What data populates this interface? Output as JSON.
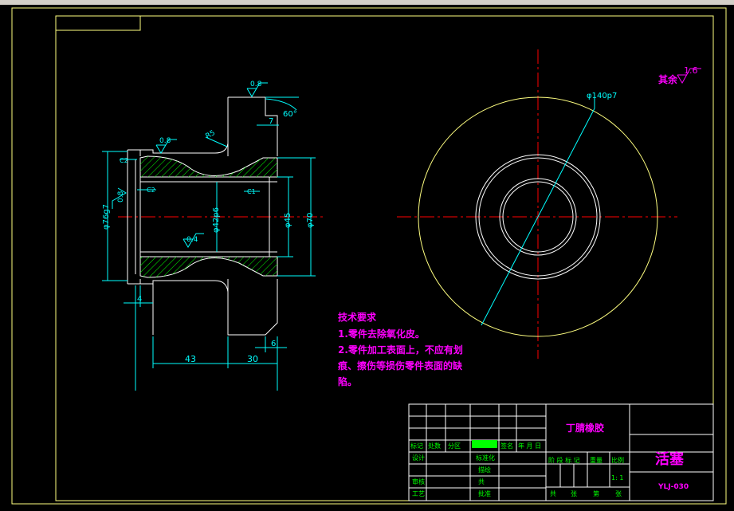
{
  "dims": {
    "d76": "φ76g7",
    "d42": "φ42p6",
    "d45": "φ45",
    "d70": "φ70",
    "d140": "φ140p7",
    "len43": "43",
    "len30": "30",
    "len4": "4",
    "len6": "6",
    "len7": "7",
    "ang60": "60°",
    "r5": "R5",
    "c2a": "C2",
    "c2b": "C2",
    "c1": "C1"
  },
  "roughness": {
    "r1": "0.8",
    "r2": "0.8",
    "r3": "0.8",
    "r4": "0.4",
    "rest_label": "其余",
    "rest_value": "1.6"
  },
  "notes": {
    "title": "技术要求",
    "line1": "1.零件去除氧化皮。",
    "line2": "2.零件加工表面上，不应有划",
    "line3": "痕、擦伤等损伤零件表面的缺",
    "line4": "陷。"
  },
  "title_block": {
    "material": "丁腈橡胶",
    "part_name": "活塞",
    "drawing_no": "YLJ-030",
    "mark": "标记",
    "count": "处数",
    "zone": "分区",
    "sign": "签名",
    "date": "年 月 日",
    "design": "设计",
    "standardize": "标准化",
    "draw": "描绘",
    "review": "审核",
    "craft": "工艺",
    "approve": "批准",
    "stage_mark": "阶 段 标 记",
    "weight": "重量",
    "scale": "比例",
    "scale_value": "1: 1",
    "total": "共",
    "sheets": "张",
    "page": "第",
    "sheet": "张"
  },
  "colors": {
    "frame": "#ffff80",
    "dim": "#00ffff",
    "center": "#ff0000",
    "hatch": "#00ff00",
    "text": "#ff00ff",
    "title_green": "#00ff00"
  }
}
